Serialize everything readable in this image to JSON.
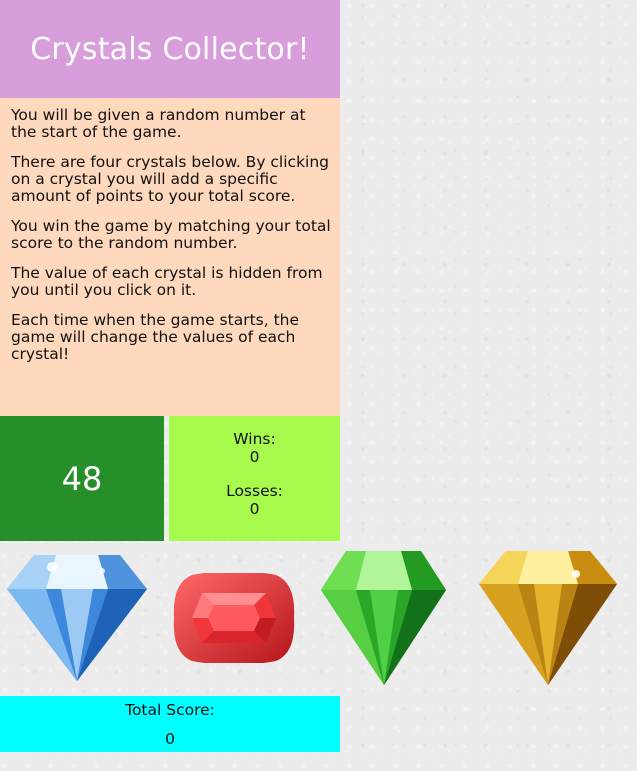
{
  "title": "Crystals Collector!",
  "instructions": [
    "You will be given a random number at the start of the game.",
    "There are four crystals below. By clicking on a crystal you will add a specific amount of points to your total score.",
    "You win the game by matching your total score to the random number.",
    "The value of each crystal is hidden from you until you click on it.",
    "Each time when the game starts, the game will change the values of each crystal!"
  ],
  "target_number": "48",
  "stats": {
    "wins_label": "Wins:",
    "wins": "0",
    "losses_label": "Losses:",
    "losses": "0"
  },
  "crystals": [
    {
      "name": "blue-diamond",
      "color": "#3f8fe0"
    },
    {
      "name": "red-ruby",
      "color": "#e8262c"
    },
    {
      "name": "green-emerald",
      "color": "#2fb82a"
    },
    {
      "name": "yellow-topaz",
      "color": "#d8a017"
    }
  ],
  "total": {
    "label": "Total Score:",
    "value": "0"
  }
}
